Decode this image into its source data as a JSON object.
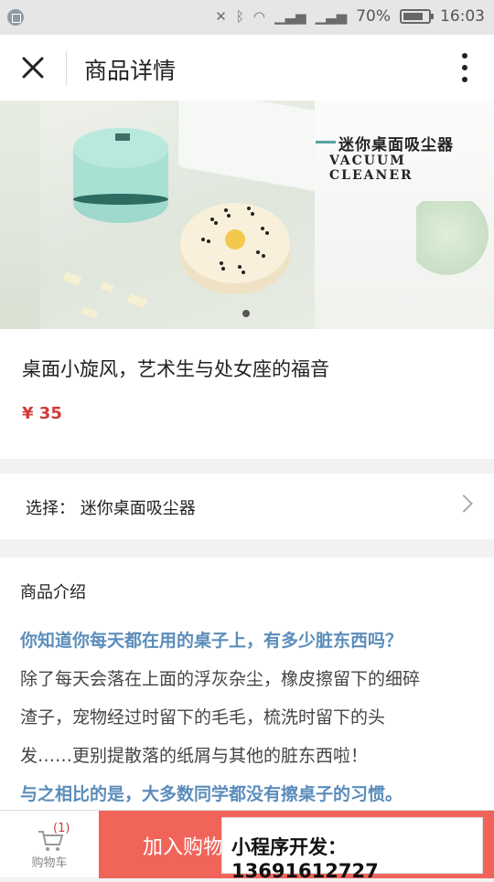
{
  "status_bar": {
    "battery": "70%",
    "time": "16:03"
  },
  "nav": {
    "title": "商品详情"
  },
  "banner": {
    "brand_cn": "迷你桌面吸尘器",
    "brand_en": "VACUUM CLEANER"
  },
  "product": {
    "title": "桌面小旋风，艺术生与处女座的福音",
    "price": "¥ 35"
  },
  "option": {
    "label": "选择：  迷你桌面吸尘器"
  },
  "intro": {
    "heading": "商品介绍",
    "lines": [
      "你知道你每天都在用的桌子上，有多少脏东西吗？",
      "除了每天会落在上面的浮灰杂尘，橡皮擦留下的细碎",
      "渣子，宠物经过时留下的毛毛，梳洗时留下的头",
      "发……更别提散落的纸屑与其他的脏东西啦！",
      "与之相比的是，大多数同学都没有擦桌子的习惯。"
    ]
  },
  "bottom": {
    "cart_count": "(1)",
    "cart_label": "购物车",
    "add_label": "加入购物",
    "overlay": "小程序开发：13691612727"
  }
}
